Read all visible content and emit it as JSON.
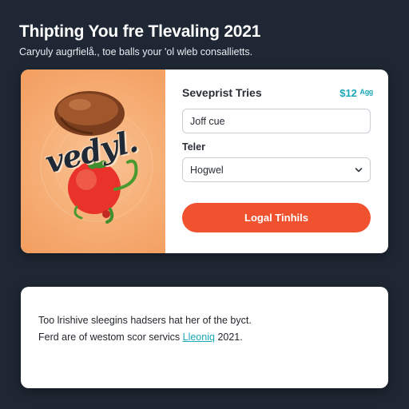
{
  "header": {
    "title": "Thipting You fre Tlevaling 2021",
    "subtitle": "Caryuly augrfielå., toe balls your 'ol wleb consallietts."
  },
  "product_card": {
    "art_text": "vedyl.",
    "product_name": "Sevеprist Tries",
    "price": "$12 ᴬᵍᵍ",
    "name_input": {
      "value": "Joff cue",
      "placeholder": ""
    },
    "field_label": "Teler",
    "select": {
      "selected": "Hogwel"
    },
    "cta_label": "Logal Tinhils"
  },
  "info_card": {
    "line1": "Too lrishive sleegins hadsers hat her of the byct.",
    "line2_prefix": "Ferd are of westom scor servics",
    "line2_link": "Lleoniq",
    "line2_suffix": "2021."
  },
  "colors": {
    "background": "#1e2733",
    "accent_button": "#f0512f",
    "price_color": "#1aa7b8",
    "art_background": "#f6ad73"
  },
  "icons": [
    "chevron-down-icon",
    "food-illustration"
  ]
}
